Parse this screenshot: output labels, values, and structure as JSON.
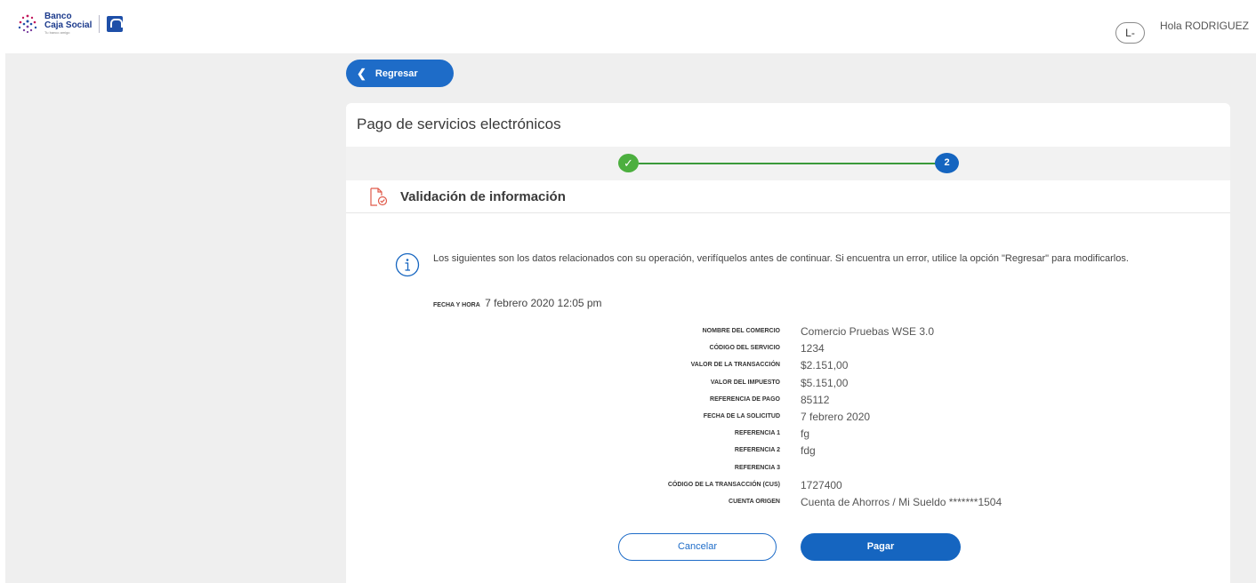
{
  "header": {
    "brand_line1": "Banco",
    "brand_line2": "Caja Social",
    "brand_tagline": "Tu banco amigo",
    "avatar_initials": "L-",
    "greeting": "Hola RODRIGUEZ"
  },
  "nav": {
    "back_label": "Regresar"
  },
  "page": {
    "title": "Pago de servicios electrónicos",
    "stepper": {
      "completed_mark": "✓",
      "current_step": "2"
    },
    "section_title": "Validación de información",
    "info_message": "Los siguientes son los datos relacionados con su operación, verifíquelos antes de continuar. Si encuentra un error, utilice la opción \"Regresar\" para modificarlos.",
    "fecha_label": "FECHA Y HORA",
    "fecha_value": "7 febrero 2020 12:05 pm"
  },
  "details": [
    {
      "label": "NOMBRE DEL COMERCIO",
      "value": "Comercio Pruebas WSE 3.0"
    },
    {
      "label": "CÓDIGO DEL SERVICIO",
      "value": "1234"
    },
    {
      "label": "VALOR DE LA TRANSACCIÓN",
      "value": "$2.151,00"
    },
    {
      "label": "VALOR DEL IMPUESTO",
      "value": "$5.151,00"
    },
    {
      "label": "REFERENCIA DE PAGO",
      "value": "85112"
    },
    {
      "label": "FECHA DE LA SOLICITUD",
      "value": "7 febrero 2020"
    },
    {
      "label": "REFERENCIA 1",
      "value": "fg"
    },
    {
      "label": "REFERENCIA 2",
      "value": "fdg"
    },
    {
      "label": "REFERENCIA 3",
      "value": ""
    },
    {
      "label": "CÓDIGO DE LA TRANSACCIÓN (CUS)",
      "value": "1727400"
    },
    {
      "label": "CUENTA ORIGEN",
      "value": "Cuenta de Ahorros / Mi Sueldo *******1504"
    }
  ],
  "actions": {
    "cancel_label": "Cancelar",
    "pay_label": "Pagar"
  },
  "colors": {
    "primary": "#1565c0",
    "success": "#4caf3f",
    "background": "#efefef",
    "icon_accent": "#e05a4a"
  },
  "icons": {
    "back": "chevron-left-icon",
    "step_done": "check-icon",
    "section": "document-check-icon",
    "info": "info-icon"
  }
}
